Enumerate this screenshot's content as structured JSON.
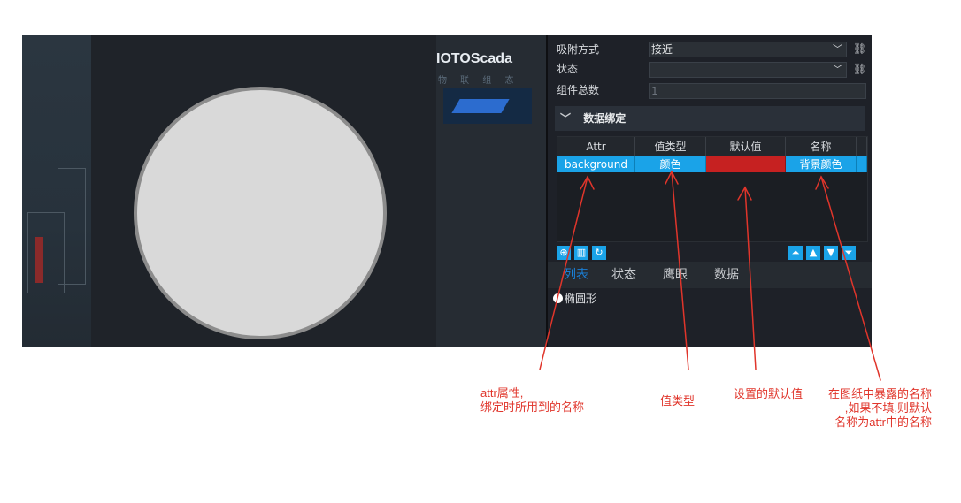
{
  "colors": {
    "accent": "#1aa3e8",
    "annotation": "#e0352b",
    "default_value": "#c62121"
  },
  "canvas": {
    "shape": "circle",
    "fill": "#d9d9d9",
    "stroke": "#8c8c8c"
  },
  "brand": {
    "logo": "IOTOScada",
    "subtitle": "物 联 组 态"
  },
  "properties": {
    "snap": {
      "label": "吸附方式",
      "value": "接近"
    },
    "state": {
      "label": "状态",
      "value": ""
    },
    "count": {
      "label": "组件总数",
      "value": "1"
    }
  },
  "binding": {
    "section_title": "数据绑定",
    "columns": [
      "Attr",
      "值类型",
      "默认值",
      "名称"
    ],
    "rows": [
      {
        "attr": "background",
        "type": "颜色",
        "default": "",
        "name": "背景颜色"
      }
    ]
  },
  "toolbar": {
    "left_icons": [
      "add-icon",
      "delete-icon",
      "refresh-icon"
    ],
    "right_icons": [
      "move-top-icon",
      "move-up-icon",
      "move-down-icon",
      "move-bottom-icon"
    ]
  },
  "tabs": [
    "列表",
    "状态",
    "鹰眼",
    "数据"
  ],
  "tree": {
    "item": "椭圆形"
  },
  "annotations": {
    "attr": [
      "attr属性,",
      "绑定时所用到的名称"
    ],
    "type": "值类型",
    "default": "设置的默认值",
    "name": [
      "在图纸中暴露的名称",
      ",如果不填,则默认",
      "名称为attr中的名称"
    ]
  }
}
